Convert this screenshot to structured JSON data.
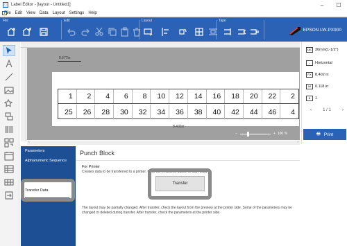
{
  "window": {
    "title": "Label Editor - [layout - Untitled1]",
    "minimize": "–",
    "maximize": "☐"
  },
  "menu": [
    "File",
    "Edit",
    "View",
    "Data",
    "Layout",
    "Settings",
    "Help"
  ],
  "toolbar": {
    "groups": {
      "file": "File",
      "edit": "Edit",
      "layout": "Layout",
      "tape": "Tape"
    },
    "printer": "EPSON LW-PX900",
    "accent": "#2b62b5"
  },
  "canvas": {
    "top_dimension": "0.677in",
    "bottom_dimension": "8.402in",
    "zoom": "100 %",
    "zoom_minus": "−",
    "zoom_plus": "+",
    "row1": [
      "1",
      "2",
      "4",
      "6",
      "8",
      "10",
      "12",
      "14",
      "16",
      "18",
      "20",
      "22",
      "2"
    ],
    "row2": [
      "25",
      "26",
      "28",
      "30",
      "32",
      "34",
      "36",
      "38",
      "40",
      "42",
      "44",
      "46",
      "4"
    ]
  },
  "right_panel": {
    "tape": "36mm(1-1/2\")",
    "orientation": "Horizontal",
    "length": "8.402 in",
    "margin": "0.118 in",
    "copies": "1",
    "page": "1 / 1",
    "print": "Print",
    "ic_tape": "ABC",
    "ic_length": "FIX",
    "ic_margin": "AB"
  },
  "nav": {
    "parameters": "Parameters",
    "alphanumeric": "Alphanumeric Sequence",
    "transfer_data": "Transfer Data"
  },
  "panel": {
    "title": "Punch Block",
    "for_printer": "For Printer",
    "desc": "Creates data to be transferred to a printer. Click the [Transfer] button to start Data",
    "transfer_button": "Transfer",
    "note": "The layout may be partially changed. After transfer, check the layout from the preview at the printer side. Some of the parameters may be changed or deleted during transfer. After transfer, check the parameters at the printer side."
  }
}
